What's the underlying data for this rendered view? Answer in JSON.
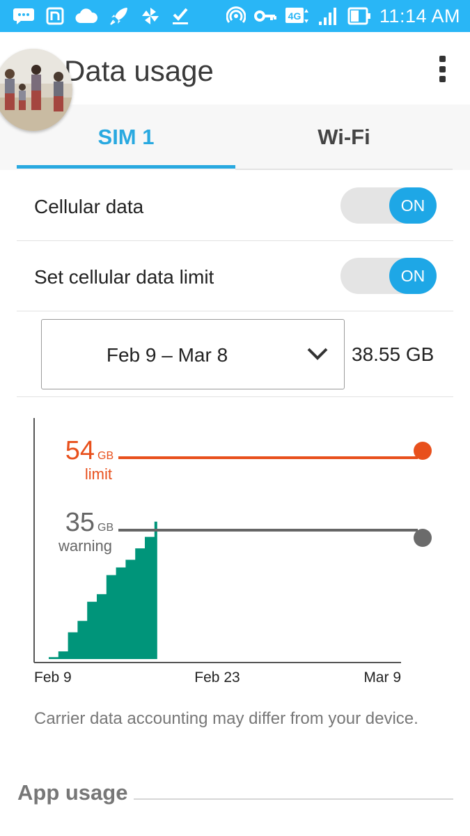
{
  "status_bar": {
    "time": "11:14 AM",
    "network_type": "4G",
    "icons": [
      "messages-icon",
      "nfc-icon",
      "cloud-icon",
      "rocket-icon",
      "pinwheel-icon",
      "download-done-icon",
      "hotspot-icon",
      "vpn-key-icon",
      "network-type-icon",
      "signal-icon",
      "battery-icon"
    ]
  },
  "header": {
    "title": "Data usage",
    "menu_icon": "more-vert-icon",
    "avatar": "profile-photo"
  },
  "tabs": [
    {
      "label": "SIM 1",
      "selected": true
    },
    {
      "label": "Wi-Fi",
      "selected": false
    }
  ],
  "settings": {
    "cellular_data": {
      "label": "Cellular data",
      "state": "ON"
    },
    "data_limit": {
      "label": "Set cellular data limit",
      "state": "ON"
    }
  },
  "cycle": {
    "range": "Feb 9 – Mar 8",
    "total": "38.55 GB",
    "dropdown_icon": "chevron-down-icon"
  },
  "chart_data": {
    "type": "area",
    "limit": {
      "value": "54",
      "unit": "GB",
      "label": "limit",
      "color": "#e8501c"
    },
    "warning": {
      "value": "35",
      "unit": "GB",
      "label": "warning",
      "color": "#666666"
    },
    "x_ticks": [
      "Feb 9",
      "Feb 23",
      "Mar 9"
    ],
    "series": [
      {
        "color": "#00957a",
        "x": [
          "Feb 9",
          "Feb 10",
          "Feb 11",
          "Feb 12",
          "Feb 13",
          "Feb 14",
          "Feb 15",
          "Feb 16",
          "Feb 17",
          "Feb 18",
          "Feb 19",
          "Feb 20"
        ],
        "y": [
          0.5,
          2,
          7,
          10,
          15,
          17,
          22,
          24,
          26,
          29,
          32,
          36
        ]
      }
    ]
  },
  "note": "Carrier data accounting may differ from your device.",
  "app_usage": {
    "title": "App usage"
  }
}
